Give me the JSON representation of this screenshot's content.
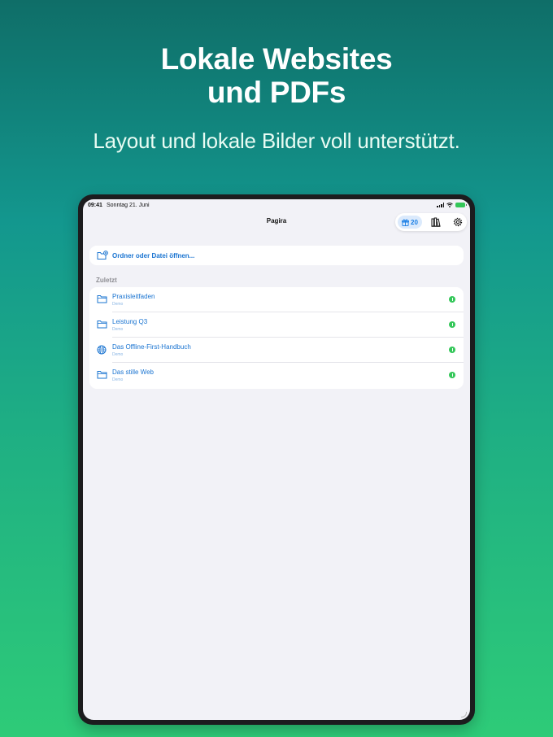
{
  "promo": {
    "title_line1": "Lokale Websites",
    "title_line2": "und PDFs",
    "subtitle": "Layout und lokale Bilder voll unterstützt."
  },
  "status_bar": {
    "time": "09:41",
    "date": "Sonntag 21. Juni"
  },
  "nav": {
    "title": "Pagira",
    "gift_count": "20",
    "icons": [
      "gift-icon",
      "library-icon",
      "gear-icon"
    ]
  },
  "open_action": {
    "label": "Ordner oder Datei öffnen...",
    "icon": "folder-plus-icon"
  },
  "recent": {
    "header": "Zuletzt",
    "items": [
      {
        "title": "Praxisleitfaden",
        "subtitle": "Demo",
        "icon": "folder-icon"
      },
      {
        "title": "Leistung Q3",
        "subtitle": "Demo",
        "icon": "folder-icon"
      },
      {
        "title": "Das Offline-First-Handbuch",
        "subtitle": "Demo",
        "icon": "globe-icon"
      },
      {
        "title": "Das stille Web",
        "subtitle": "Demo",
        "icon": "folder-icon"
      }
    ]
  },
  "colors": {
    "accent": "#1a74d1",
    "downloaded": "#34c759",
    "background": "#f2f2f7"
  }
}
